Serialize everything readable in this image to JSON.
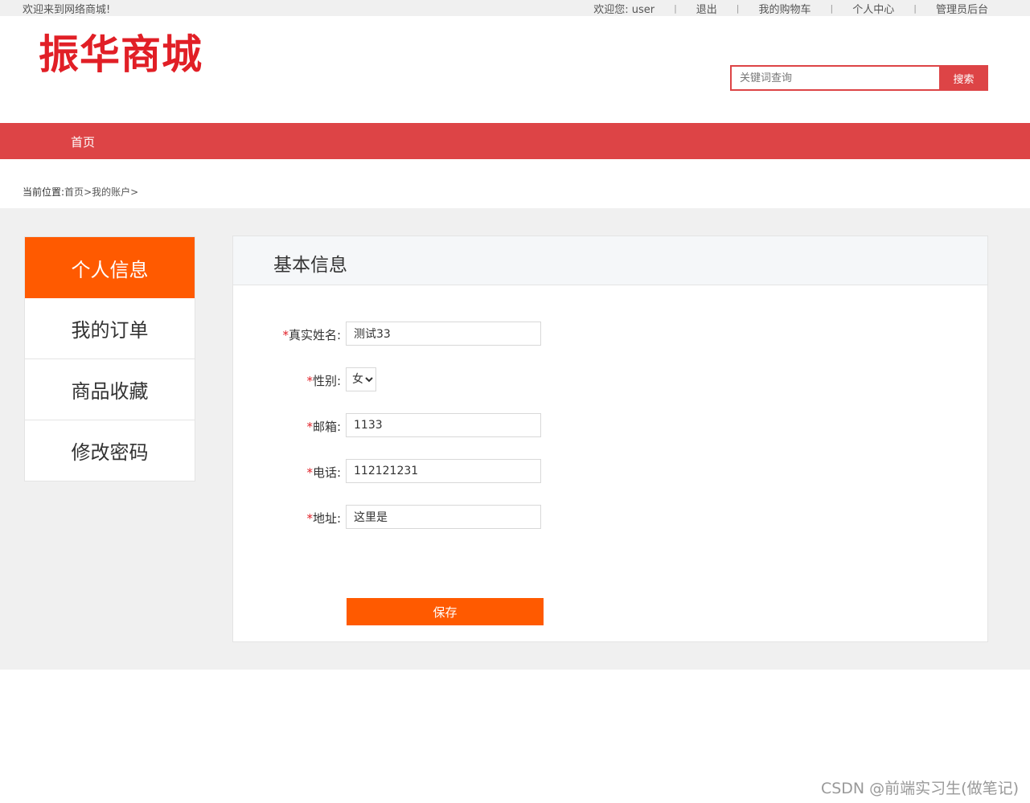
{
  "topbar": {
    "welcome": "欢迎来到网络商城!",
    "user_greeting": "欢迎您:  user",
    "logout": "退出",
    "cart": "我的购物车",
    "profile": "个人中心",
    "admin": "管理员后台",
    "separator": "|"
  },
  "header": {
    "logo_text": "振华商城",
    "search_placeholder": "关键词查询",
    "search_button": "搜索"
  },
  "nav": {
    "home": "首页"
  },
  "breadcrumb": {
    "prefix": "当前位置:",
    "home": "首页",
    "sep1": ">",
    "account": "我的账户",
    "sep2": ">"
  },
  "sidebar": {
    "items": [
      {
        "label": "个人信息",
        "active": true
      },
      {
        "label": "我的订单",
        "active": false
      },
      {
        "label": "商品收藏",
        "active": false
      },
      {
        "label": "修改密码",
        "active": false
      }
    ]
  },
  "panel": {
    "title": "基本信息",
    "required_mark": "*",
    "fields": {
      "realname": {
        "label": "真实姓名:",
        "value": "测试33"
      },
      "gender": {
        "label": "性别:",
        "value": "女"
      },
      "email": {
        "label": "邮箱:",
        "value": "1133"
      },
      "phone": {
        "label": "电话:",
        "value": "112121231"
      },
      "address": {
        "label": "地址:",
        "value": "这里是"
      }
    },
    "save_button": "保存"
  },
  "watermark": "CSDN @前端实习生(做笔记)",
  "colors": {
    "brand_red": "#dd4446",
    "logo_red": "#e11f26",
    "accent_orange": "#ff5a00",
    "gray_bg": "#f0f0f0"
  }
}
